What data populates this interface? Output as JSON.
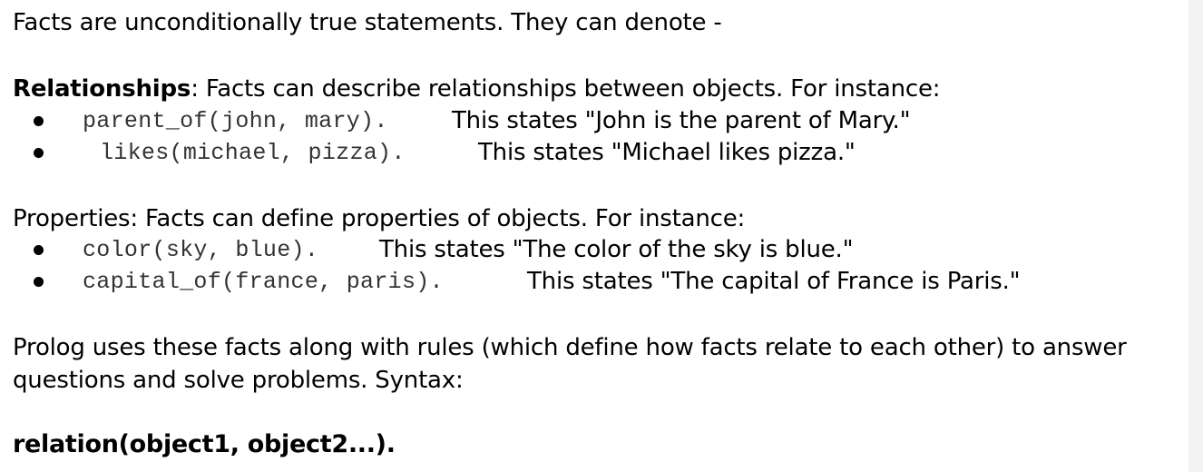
{
  "intro": "Facts are unconditionally true statements. They can denote -",
  "relationships": {
    "heading": "Relationships",
    "text": ": Facts can describe relationships between objects. For instance:",
    "items": [
      {
        "code": "parent_of(john, mary).",
        "description": "This states \"John is the parent of Mary.\""
      },
      {
        "code": "likes(michael, pizza).",
        "description": "This states \"Michael likes pizza.\""
      }
    ]
  },
  "properties": {
    "text": "Properties: Facts can define properties of objects. For instance:",
    "items": [
      {
        "code": "color(sky, blue).",
        "description": "This states \"The color of the sky is blue.\""
      },
      {
        "code": "capital_of(france, paris).",
        "description": "This states \"The capital of France is Paris.\""
      }
    ]
  },
  "prolog_note": "Prolog uses these facts along with rules (which define how facts relate to each other) to answer questions and solve problems. Syntax:",
  "syntax": "relation(object1, object2...)."
}
